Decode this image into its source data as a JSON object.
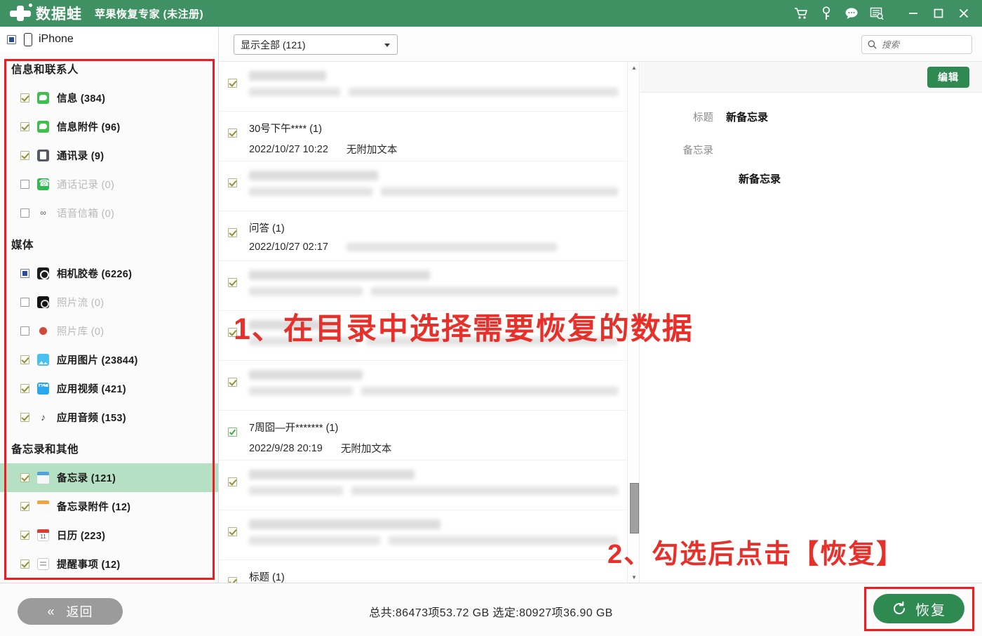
{
  "titlebar": {
    "brand": "数据蛙",
    "product": "苹果恢复专家 (未注册)",
    "icons": [
      {
        "name": "cart-icon",
        "label": "购物车"
      },
      {
        "name": "key-icon",
        "label": "注册"
      },
      {
        "name": "chat-icon",
        "label": "在线客服"
      },
      {
        "name": "feedback-icon",
        "label": "反馈"
      },
      {
        "name": "minimize-icon",
        "label": "最小化"
      },
      {
        "name": "maximize-icon",
        "label": "最大化"
      },
      {
        "name": "close-icon",
        "label": "关闭"
      }
    ]
  },
  "sidebar": {
    "device": {
      "label": "iPhone",
      "checkbox": "partial"
    },
    "back_button": "返回",
    "back_chevron": "«",
    "groups": [
      {
        "title": "信息和联系人",
        "items": [
          {
            "label": "信息 (384)",
            "icon": "message-icon",
            "checkbox": "checked",
            "disabled": false,
            "selected": false
          },
          {
            "label": "信息附件 (96)",
            "icon": "message-attachment-icon",
            "checkbox": "checked",
            "disabled": false,
            "selected": false
          },
          {
            "label": "通讯录 (9)",
            "icon": "contacts-icon",
            "checkbox": "checked",
            "disabled": false,
            "selected": false
          },
          {
            "label": "通话记录 (0)",
            "icon": "call-history-icon",
            "checkbox": "unchecked",
            "disabled": true,
            "selected": false
          },
          {
            "label": "语音信箱 (0)",
            "icon": "voicemail-icon",
            "checkbox": "unchecked",
            "disabled": true,
            "selected": false
          }
        ]
      },
      {
        "title": "媒体",
        "items": [
          {
            "label": "相机胶卷 (6226)",
            "icon": "camera-roll-icon",
            "checkbox": "partial",
            "disabled": false,
            "selected": false
          },
          {
            "label": "照片流 (0)",
            "icon": "photo-stream-icon",
            "checkbox": "unchecked",
            "disabled": true,
            "selected": false
          },
          {
            "label": "照片库 (0)",
            "icon": "photo-library-icon",
            "checkbox": "unchecked",
            "disabled": true,
            "selected": false
          },
          {
            "label": "应用图片 (23844)",
            "icon": "app-photos-icon",
            "checkbox": "checked",
            "disabled": false,
            "selected": false
          },
          {
            "label": "应用视频 (421)",
            "icon": "app-videos-icon",
            "checkbox": "checked",
            "disabled": false,
            "selected": false
          },
          {
            "label": "应用音频 (153)",
            "icon": "app-audio-icon",
            "checkbox": "checked",
            "disabled": false,
            "selected": false
          }
        ]
      },
      {
        "title": "备忘录和其他",
        "items": [
          {
            "label": "备忘录 (121)",
            "icon": "notes-icon",
            "checkbox": "checked",
            "disabled": false,
            "selected": true
          },
          {
            "label": "备忘录附件 (12)",
            "icon": "notes-attachment-icon",
            "checkbox": "checked",
            "disabled": false,
            "selected": false
          },
          {
            "label": "日历 (223)",
            "icon": "calendar-icon",
            "checkbox": "checked",
            "disabled": false,
            "selected": false
          },
          {
            "label": "提醒事项 (12)",
            "icon": "reminders-icon",
            "checkbox": "checked",
            "disabled": false,
            "selected": false
          }
        ]
      }
    ]
  },
  "toolbar": {
    "filter_value": "显示全部 (121)",
    "search_placeholder": "搜索",
    "search_value": ""
  },
  "list": {
    "rows": [
      {
        "redacted": true,
        "checkbox": "checked",
        "title": "",
        "date": "",
        "preview": ""
      },
      {
        "redacted": false,
        "checkbox": "checked",
        "title": "30号下午**** (1)",
        "date": "2022/10/27 10:22",
        "preview": "无附加文本"
      },
      {
        "redacted": true,
        "checkbox": "checked",
        "title": "",
        "date": "",
        "preview": ""
      },
      {
        "redacted": false,
        "checkbox": "checked",
        "title": "问答 (1)",
        "date": "2022/10/27 02:17",
        "preview": ""
      },
      {
        "redacted": true,
        "checkbox": "checked",
        "title": "",
        "date": "",
        "preview": ""
      },
      {
        "redacted": true,
        "checkbox": "checked",
        "title": "",
        "date": "",
        "preview": ""
      },
      {
        "redacted": true,
        "checkbox": "checked",
        "title": "",
        "date": "",
        "preview": ""
      },
      {
        "redacted": false,
        "checkbox": "checked-green",
        "title": "7周囵—开******* (1)",
        "date": "2022/9/28 20:19",
        "preview": "无附加文本"
      },
      {
        "redacted": true,
        "checkbox": "checked",
        "title": "",
        "date": "",
        "preview": ""
      },
      {
        "redacted": true,
        "checkbox": "checked",
        "title": "",
        "date": "",
        "preview": ""
      },
      {
        "redacted": false,
        "checkbox": "checked",
        "title": "标题 (1)",
        "date": "",
        "preview": ""
      }
    ]
  },
  "detail": {
    "edit_button": "编辑",
    "title_label": "标题",
    "title_value": "新备忘录",
    "note_label": "备忘录",
    "note_value": "新备忘录"
  },
  "bottom": {
    "stats": "总共:86473项53.72 GB 选定:80927项36.90 GB",
    "recover_button": "恢复"
  },
  "annotations": {
    "step1": "1、在目录中选择需要恢复的数据",
    "step2": "2、勾选后点击【恢复】"
  },
  "colors": {
    "brand_green": "#3f9163",
    "button_green": "#2f8a52",
    "annotation_red": "#e8302b",
    "highlight_green": "#b5e0c4",
    "box_red": "#ef1d22"
  }
}
